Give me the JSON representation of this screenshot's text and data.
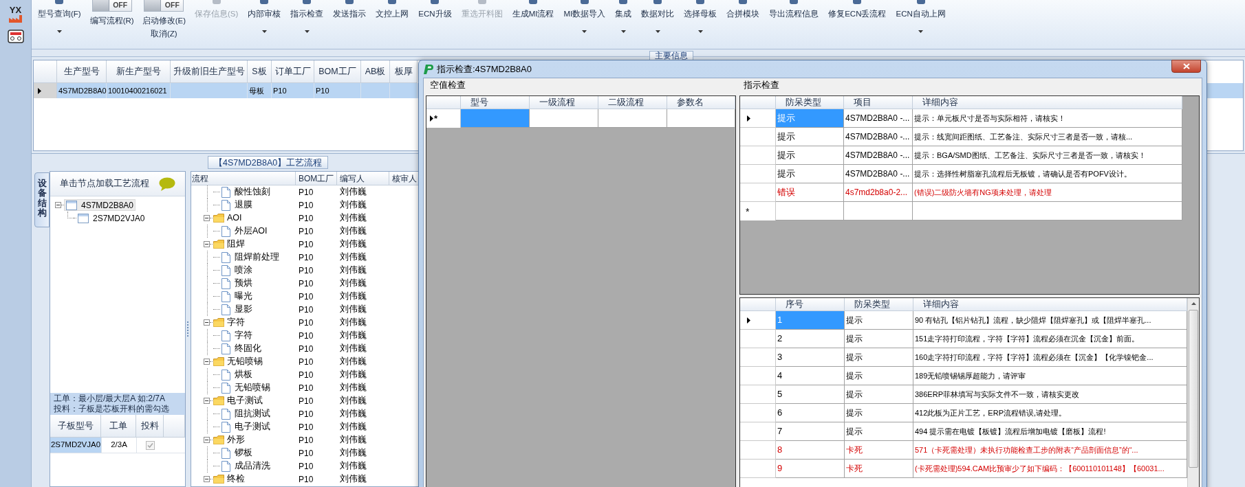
{
  "app": {
    "logo": "YX"
  },
  "toolbar": [
    {
      "kind": "button",
      "label": "型号查询(F)",
      "dropdown": true,
      "disabled": false
    },
    {
      "kind": "toggle",
      "switch_text": "OFF",
      "on": false,
      "label": "编写流程(R)"
    },
    {
      "kind": "toggle",
      "switch_text": "OFF",
      "on": false,
      "label": "启动修改(E)",
      "sublabel": "取消(Z)"
    },
    {
      "kind": "button",
      "label": "保存信息(S)",
      "dropdown": false,
      "disabled": true
    },
    {
      "kind": "button",
      "label": "内部审核",
      "dropdown": true,
      "disabled": false
    },
    {
      "kind": "button",
      "label": "指示检查",
      "dropdown": true,
      "disabled": false
    },
    {
      "kind": "button",
      "label": "发送指示",
      "dropdown": false,
      "disabled": false
    },
    {
      "kind": "button",
      "label": "文控上网",
      "dropdown": false,
      "disabled": false
    },
    {
      "kind": "button",
      "label": "ECN升级",
      "dropdown": false,
      "disabled": false
    },
    {
      "kind": "button",
      "label": "重选开料图",
      "dropdown": false,
      "disabled": true
    },
    {
      "kind": "button",
      "label": "生成MI流程",
      "dropdown": false,
      "disabled": false
    },
    {
      "kind": "button",
      "label": "MI数据导入",
      "dropdown": true,
      "disabled": false
    },
    {
      "kind": "button",
      "label": "集成",
      "dropdown": true,
      "disabled": false
    },
    {
      "kind": "button",
      "label": "数据对比",
      "dropdown": true,
      "disabled": false
    },
    {
      "kind": "button",
      "label": "选择母板",
      "dropdown": true,
      "disabled": false
    },
    {
      "kind": "button",
      "label": "合拼模块",
      "dropdown": false,
      "disabled": false
    },
    {
      "kind": "button",
      "label": "导出流程信息",
      "dropdown": false,
      "disabled": false
    },
    {
      "kind": "button",
      "label": "修复ECN丢流程",
      "dropdown": false,
      "disabled": false
    },
    {
      "kind": "button",
      "label": "ECN自动上网",
      "dropdown": true,
      "disabled": false
    }
  ],
  "main_info_tab": "主要信息",
  "main_grid": {
    "columns": [
      "生产型号",
      "新生产型号",
      "升级前旧生产型号",
      "S板",
      "订单工厂",
      "BOM工厂",
      "AB板",
      "板厚"
    ],
    "rows": [
      {
        "selected": true,
        "cells": [
          "4S7MD2B8A0",
          "10010400216021",
          null,
          "母板",
          "P10",
          "P10",
          null,
          null
        ]
      }
    ]
  },
  "process_panel": {
    "title": "【4S7MD2B8A0】工艺流程",
    "side_tab": "设备结构",
    "tree_header": "单击节点加载工艺流程",
    "tree": [
      {
        "label": "4S7MD2B8A0",
        "selected": true,
        "expanded": true,
        "children": [
          {
            "label": "2S7MD2VJA0",
            "selected": false
          }
        ]
      }
    ],
    "note": [
      "工单：最小层/最大层A 如:2/7A",
      "投料：子板是芯板开料的需勾选"
    ],
    "sub_grid": {
      "columns": [
        "子板型号",
        "工单",
        "投料"
      ],
      "rows": [
        {
          "selected": true,
          "cells": [
            "2S7MD2VJA0",
            "2/3A"
          ],
          "checked": true
        }
      ]
    }
  },
  "flow_grid": {
    "columns": [
      "流程",
      "BOM工厂",
      "编写人",
      "核审人"
    ],
    "groups": [
      {
        "children": [
          {
            "label": "酸性蚀刻",
            "factory": "P10",
            "author": "刘伟巍"
          },
          {
            "label": "退膜",
            "factory": "P10",
            "author": "刘伟巍"
          }
        ]
      },
      {
        "label": "AOI",
        "factory": "P10",
        "author": "刘伟巍",
        "expanded": true,
        "children": [
          {
            "label": "外层AOI",
            "factory": "P10",
            "author": "刘伟巍"
          }
        ]
      },
      {
        "label": "阻焊",
        "factory": "P10",
        "author": "刘伟巍",
        "expanded": true,
        "children": [
          {
            "label": "阻焊前处理",
            "factory": "P10",
            "author": "刘伟巍"
          },
          {
            "label": "喷涂",
            "factory": "P10",
            "author": "刘伟巍"
          },
          {
            "label": "预烘",
            "factory": "P10",
            "author": "刘伟巍"
          },
          {
            "label": "曝光",
            "factory": "P10",
            "author": "刘伟巍"
          },
          {
            "label": "显影",
            "factory": "P10",
            "author": "刘伟巍"
          }
        ]
      },
      {
        "label": "字符",
        "factory": "P10",
        "author": "刘伟巍",
        "expanded": true,
        "children": [
          {
            "label": "字符",
            "factory": "P10",
            "author": "刘伟巍"
          },
          {
            "label": "终固化",
            "factory": "P10",
            "author": "刘伟巍"
          }
        ]
      },
      {
        "label": "无铅喷锡",
        "factory": "P10",
        "author": "刘伟巍",
        "expanded": true,
        "children": [
          {
            "label": "烘板",
            "factory": "P10",
            "author": "刘伟巍"
          },
          {
            "label": "无铅喷锡",
            "factory": "P10",
            "author": "刘伟巍"
          }
        ]
      },
      {
        "label": "电子测试",
        "factory": "P10",
        "author": "刘伟巍",
        "expanded": true,
        "children": [
          {
            "label": "阻抗测试",
            "factory": "P10",
            "author": "刘伟巍"
          },
          {
            "label": "电子测试",
            "factory": "P10",
            "author": "刘伟巍"
          }
        ]
      },
      {
        "label": "外形",
        "factory": "P10",
        "author": "刘伟巍",
        "expanded": true,
        "children": [
          {
            "label": "锣板",
            "factory": "P10",
            "author": "刘伟巍"
          },
          {
            "label": "成品清洗",
            "factory": "P10",
            "author": "刘伟巍"
          }
        ]
      },
      {
        "label": "终检",
        "factory": "P10",
        "author": "刘伟巍",
        "expanded": true
      }
    ]
  },
  "dialog": {
    "title": "指示检查:4S7MD2B8A0",
    "null_check": {
      "title": "空值检查",
      "columns": [
        "型号",
        "一级流程",
        "二级流程",
        "参数名"
      ],
      "new_row_marker": "*"
    },
    "indication_check": {
      "title": "指示检查",
      "columns": [
        "防呆类型",
        "项目",
        "详细内容"
      ],
      "new_row_marker": "*",
      "rows": [
        {
          "kind": "hint",
          "selected": true,
          "cells": [
            "提示",
            "4S7MD2B8A0 -...",
            "提示：单元板尺寸是否与实际相符，请核实！"
          ]
        },
        {
          "kind": "hint",
          "selected": false,
          "cells": [
            "提示",
            "4S7MD2B8A0 -...",
            "提示：线宽间距图纸、工艺备注、实际尺寸三者是否一致，请核..."
          ]
        },
        {
          "kind": "hint",
          "selected": false,
          "cells": [
            "提示",
            "4S7MD2B8A0 -...",
            "提示：BGA/SMD图纸、工艺备注、实际尺寸三者是否一致，请核实！"
          ]
        },
        {
          "kind": "hint",
          "selected": false,
          "cells": [
            "提示",
            "4S7MD2B8A0 -...",
            "提示：选择性树脂塞孔流程后无板镀，请确认是否有POFV设计。"
          ]
        },
        {
          "kind": "error",
          "selected": false,
          "cells": [
            "错误",
            "4s7md2b8a0-2...",
            "(错误)二级防火墙有NG项未处理，请处理"
          ]
        }
      ]
    },
    "result_grid": {
      "columns": [
        "序号",
        "防呆类型",
        "详细内容"
      ],
      "rows": [
        {
          "kind": "hint",
          "selected": true,
          "cells": [
            "1",
            "提示",
            "90 有钻孔【铝片钻孔】流程，缺少阻焊【阻焊塞孔】或【阻焊半塞孔..."
          ]
        },
        {
          "kind": "hint",
          "selected": false,
          "cells": [
            "2",
            "提示",
            "151走字符打印流程，字符【字符】流程必须在沉金【沉金】前面。"
          ]
        },
        {
          "kind": "hint",
          "selected": false,
          "cells": [
            "3",
            "提示",
            "160走字符打印流程，字符【字符】流程必须在【沉金】【化学镍钯金..."
          ]
        },
        {
          "kind": "hint",
          "selected": false,
          "cells": [
            "4",
            "提示",
            "189无铅喷锡锡厚超能力，请评审"
          ]
        },
        {
          "kind": "hint",
          "selected": false,
          "cells": [
            "5",
            "提示",
            "386ERP菲林填写与实际文件不一致，请核实更改"
          ]
        },
        {
          "kind": "hint",
          "selected": false,
          "cells": [
            "6",
            "提示",
            "412此板为正片工艺，ERP流程错误,请处理。"
          ]
        },
        {
          "kind": "hint",
          "selected": false,
          "cells": [
            "7",
            "提示",
            "494 提示需在电镀【板镀】流程后增加电镀【磨板】流程!"
          ]
        },
        {
          "kind": "block",
          "selected": false,
          "cells": [
            "8",
            "卡死",
            "571（卡死需处理）未执行功能检查工步的附表“产品剖面信息”的“..."
          ]
        },
        {
          "kind": "block",
          "selected": false,
          "cells": [
            "9",
            "卡死",
            "(卡死需处理)594.CAM比预审少了如下编码：【600110101148】【60031..."
          ]
        }
      ]
    }
  }
}
